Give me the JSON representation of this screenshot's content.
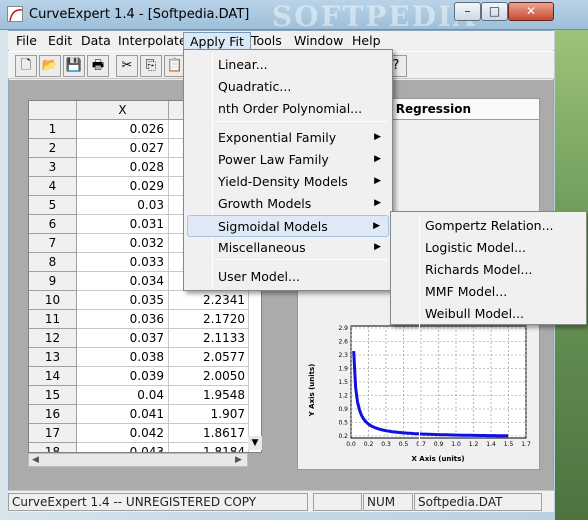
{
  "window": {
    "title": "CurveExpert 1.4 - [Softpedia.DAT]",
    "watermark": "SOFTPEDIA",
    "watermark_menu": "SOFTPEDIA",
    "min": "–",
    "max": "□",
    "close": "✕"
  },
  "menu": [
    "File",
    "Edit",
    "Data",
    "Interpolate",
    "Apply Fit",
    "Tools",
    "Window",
    "Help"
  ],
  "toolbar_icons": [
    "new-icon",
    "open-icon",
    "save-icon",
    "print-icon",
    "cut-icon",
    "copy-icon",
    "paste-icon",
    "help-icon"
  ],
  "grid": {
    "col_x": "X",
    "rows": [
      {
        "n": "1",
        "x": "0.026",
        "y": ""
      },
      {
        "n": "2",
        "x": "0.027",
        "y": ""
      },
      {
        "n": "3",
        "x": "0.028",
        "y": ""
      },
      {
        "n": "4",
        "x": "0.029",
        "y": ""
      },
      {
        "n": "5",
        "x": "0.03",
        "y": ""
      },
      {
        "n": "6",
        "x": "0.031",
        "y": ""
      },
      {
        "n": "7",
        "x": "0.032",
        "y": ""
      },
      {
        "n": "8",
        "x": "0.033",
        "y": ""
      },
      {
        "n": "9",
        "x": "0.034",
        "y": ""
      },
      {
        "n": "10",
        "x": "0.035",
        "y": "2.2341"
      },
      {
        "n": "11",
        "x": "0.036",
        "y": "2.1720"
      },
      {
        "n": "12",
        "x": "0.037",
        "y": "2.1133"
      },
      {
        "n": "13",
        "x": "0.038",
        "y": "2.0577"
      },
      {
        "n": "14",
        "x": "0.039",
        "y": "2.0050"
      },
      {
        "n": "15",
        "x": "0.04",
        "y": "1.9548"
      },
      {
        "n": "16",
        "x": "0.041",
        "y": "1.907"
      },
      {
        "n": "17",
        "x": "0.042",
        "y": "1.8617"
      },
      {
        "n": "18",
        "x": "0.043",
        "y": "1.8184"
      }
    ]
  },
  "regression": {
    "title": "Regression"
  },
  "plot": {
    "ylabel": "Y Axis (units)",
    "xlabel": "X Axis (units)",
    "yticks": [
      "2.9",
      "2.6",
      "2.3",
      "1.9",
      "1.5",
      "1.2",
      "0.9",
      "0.5",
      "0.2"
    ],
    "xticks": [
      "0.0",
      "0.2",
      "0.3",
      "0.5",
      "0.7",
      "0.9",
      "1.0",
      "1.2",
      "1.4",
      "1.5",
      "1.7"
    ]
  },
  "apply_fit": {
    "items": [
      {
        "label": "Linear...",
        "sub": false
      },
      {
        "label": "Quadratic...",
        "sub": false
      },
      {
        "label": "nth Order Polynomial...",
        "sub": false
      },
      {
        "label": "Exponential Family",
        "sub": true
      },
      {
        "label": "Power Law Family",
        "sub": true
      },
      {
        "label": "Yield-Density Models",
        "sub": true
      },
      {
        "label": "Growth Models",
        "sub": true
      },
      {
        "label": "Sigmoidal Models",
        "sub": true
      },
      {
        "label": "Miscellaneous",
        "sub": true
      },
      {
        "label": "User Model...",
        "sub": false
      }
    ],
    "arrow": "▶"
  },
  "sigmoidal": [
    "Gompertz Relation...",
    "Logistic Model...",
    "Richards Model...",
    "MMF Model...",
    "Weibull Model..."
  ],
  "status": {
    "main": "CurveExpert 1.4 -- UNREGISTERED COPY",
    "num": "NUM",
    "file": "Softpedia.DAT"
  }
}
